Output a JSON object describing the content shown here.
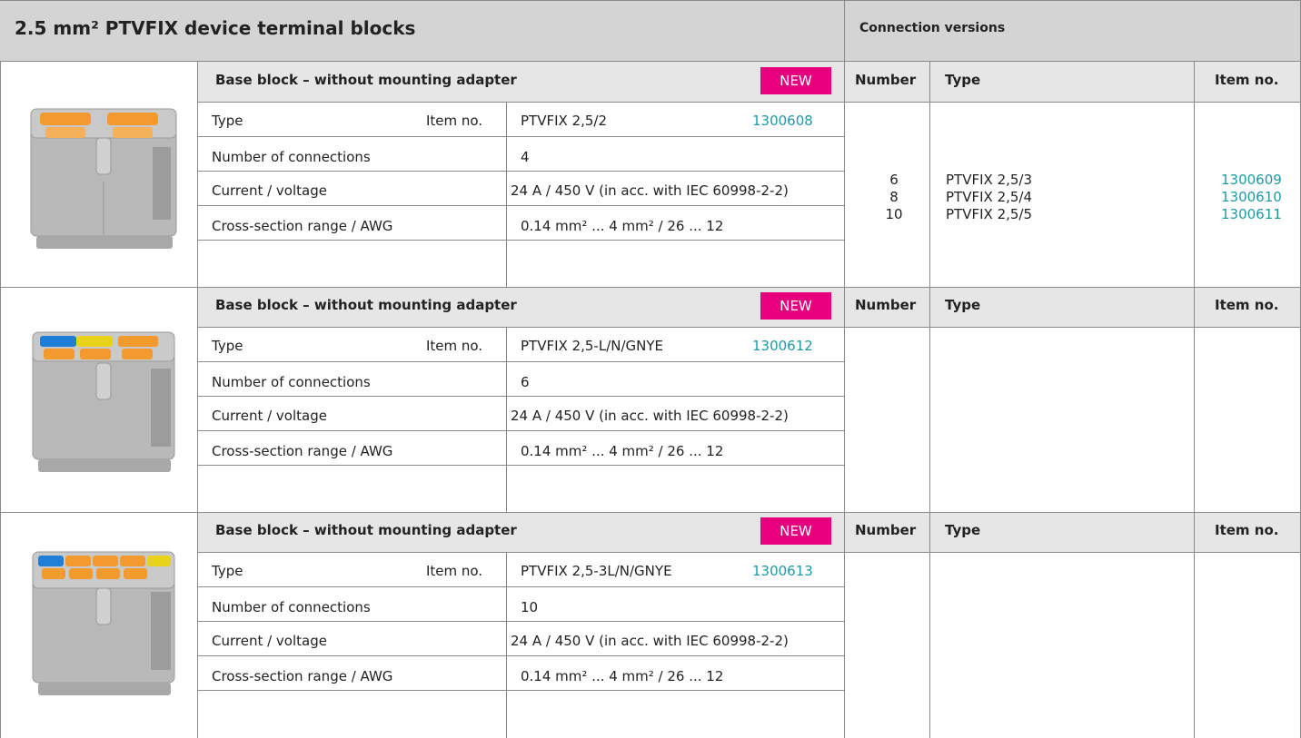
{
  "page": {
    "title": "2.5 mm² PTVFIX device terminal blocks",
    "side_title": "Connection versions"
  },
  "labels": {
    "block_header": "Base block – without mounting adapter",
    "badge": "NEW",
    "type": "Type",
    "item_no": "Item no.",
    "number_of_connections": "Number of connections",
    "current_voltage": "Current / voltage",
    "cross_section": "Cross-section range / AWG",
    "col_number": "Number",
    "col_type": "Type",
    "col_item_no": "Item no."
  },
  "sections": [
    {
      "type": "PTVFIX 2,5/2",
      "item_no": "1300608",
      "connections": "4",
      "current_voltage": "24 A / 450 V (in acc. with IEC 60998-2-2)",
      "cross_section": "0.14 mm² ... 4 mm² / 26 ... 12",
      "versions": {
        "numbers": [
          "6",
          "8",
          "10"
        ],
        "types": [
          "PTVFIX 2,5/3",
          "PTVFIX 2,5/4",
          "PTVFIX 2,5/5"
        ],
        "items": [
          "1300609",
          "1300610",
          "1300611"
        ]
      }
    },
    {
      "type": "PTVFIX 2,5-L/N/GNYE",
      "item_no": "1300612",
      "connections": "6",
      "current_voltage": "24 A / 450 V (in acc. with IEC 60998-2-2)",
      "cross_section": "0.14 mm² ... 4 mm² / 26 ... 12"
    },
    {
      "type": "PTVFIX 2,5-3L/N/GNYE",
      "item_no": "1300613",
      "connections": "10",
      "current_voltage": "24 A / 450 V (in acc. with IEC 60998-2-2)",
      "cross_section": "0.14 mm² ... 4 mm² / 26 ... 12"
    }
  ],
  "colors": {
    "header_gray": "#d4d4d4",
    "band_gray": "#e6e6e6",
    "link_teal": "#1f9aa0",
    "badge_magenta": "#e6007e",
    "terminal_gray": "#b9b9b9",
    "lever_orange": "#f39a2e",
    "accent_blue": "#1f7fd6",
    "accent_yellow": "#e8d21a"
  }
}
